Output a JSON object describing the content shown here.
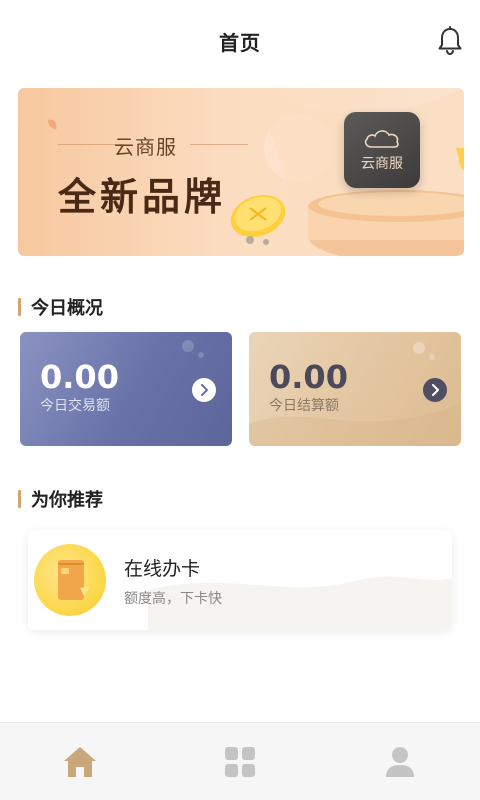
{
  "header": {
    "title": "首页"
  },
  "banner": {
    "tag": "云商服",
    "headline": "全新品牌",
    "logo_text": "云商服"
  },
  "overview": {
    "section_title": "今日概况",
    "cards": [
      {
        "value": "0.00",
        "label": "今日交易额"
      },
      {
        "value": "0.00",
        "label": "今日结算额"
      }
    ]
  },
  "recommend": {
    "section_title": "为你推荐",
    "item": {
      "title": "在线办卡",
      "subtitle": "额度高，下卡快"
    }
  },
  "bottom_nav": {
    "items": [
      {
        "icon": "home-icon",
        "active": true
      },
      {
        "icon": "grid-icon",
        "active": false
      },
      {
        "icon": "user-icon",
        "active": false
      }
    ]
  },
  "colors": {
    "accent": "#d4a26c",
    "nav_active": "#c9a77b",
    "nav_inactive": "#c4c4c4",
    "card_blue": "#6872a8",
    "card_gold": "#e2c49e"
  }
}
